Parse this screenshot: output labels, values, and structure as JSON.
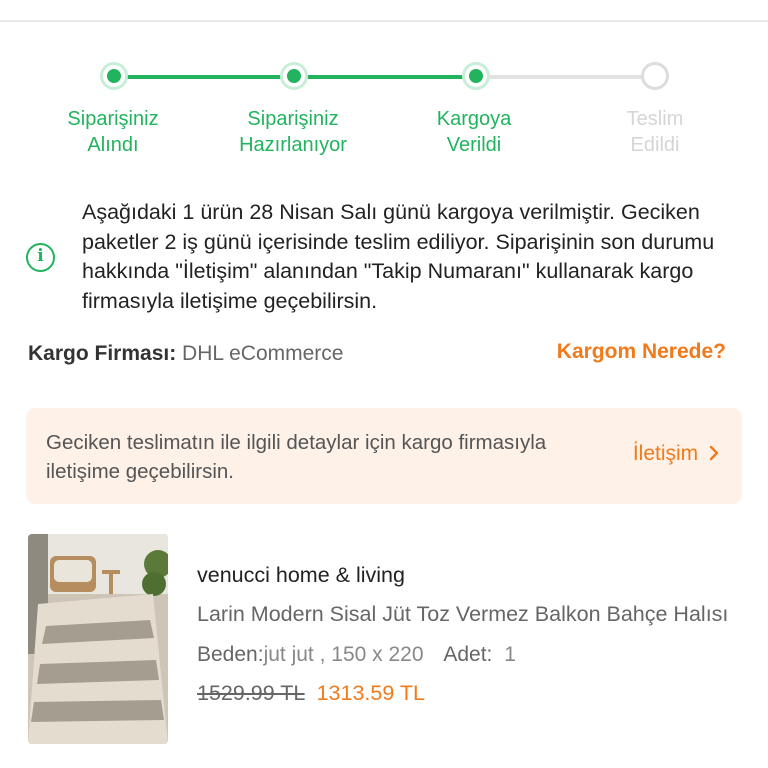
{
  "steps": [
    {
      "label_line1": "Siparişiniz",
      "label_line2": "Alındı",
      "status": "done"
    },
    {
      "label_line1": "Siparişiniz",
      "label_line2": "Hazırlanıyor",
      "status": "done"
    },
    {
      "label_line1": "Kargoya",
      "label_line2": "Verildi",
      "status": "done"
    },
    {
      "label_line1": "Teslim",
      "label_line2": "Edildi",
      "status": "todo"
    }
  ],
  "info": {
    "icon": "info-icon",
    "text": "Aşağıdaki 1 ürün 28 Nisan Salı günü kargoya verilmiştir. Geciken paketler 2 iş günü içerisinde teslim ediliyor. Siparişinin son durumu hakkında \"İletişim\" alanından \"Takip Numaranı\" kullanarak kargo firmasıyla iletişime geçebilirsin."
  },
  "cargo": {
    "label": "Kargo Firması:",
    "value": "DHL eCommerce",
    "where_link": "Kargom Nerede?"
  },
  "notice": {
    "text": "Geciken teslimatın ile ilgili detaylar için kargo firmasıyla iletişime geçebilirsin.",
    "link": "İletişim",
    "link_icon": "chevron-right-icon"
  },
  "product": {
    "brand": "venucci home & living",
    "name": "Larin Modern Sisal Jüt Toz Vermez Balkon Bahçe Halısı",
    "variant_label": "Beden:",
    "variant_value": "jut jut , 150 x 220",
    "qty_label": "Adet:",
    "qty_value": "1",
    "old_price": "1529.99 TL",
    "new_price": "1313.59 TL"
  },
  "colors": {
    "accent_green": "#21b35d",
    "accent_orange": "#f27a1a",
    "notice_bg": "#fdf1e8"
  }
}
